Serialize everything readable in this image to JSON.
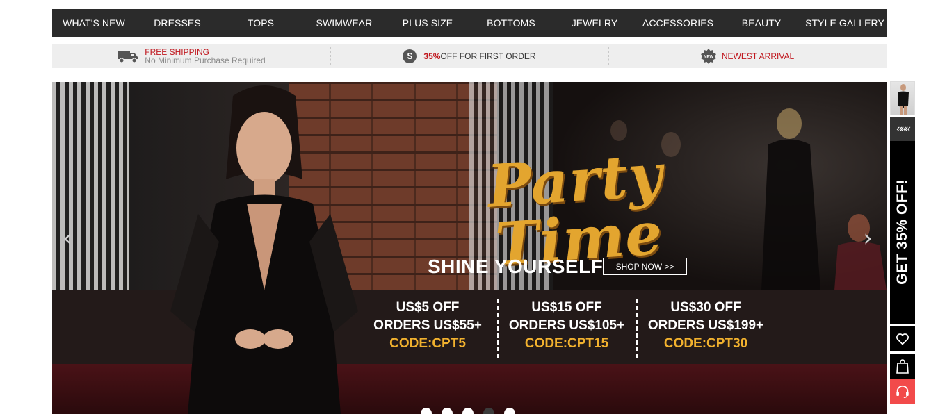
{
  "nav": {
    "items": [
      "WHAT'S NEW",
      "DRESSES",
      "TOPS",
      "SWIMWEAR",
      "PLUS SIZE",
      "BOTTOMS",
      "JEWELRY",
      "ACCESSORIES",
      "BEAUTY",
      "STYLE GALLERY"
    ]
  },
  "info": {
    "shipping_title": "FREE SHIPPING",
    "shipping_sub": "No Minimum Purchase Required",
    "discount_pct": "35%",
    "discount_text": "OFF FOR FIRST ORDER",
    "newest_badge": "NEW",
    "newest_text": "NEWEST ARRIVAL"
  },
  "hero": {
    "title": "Party Time",
    "tagline": "SHINE YOURSELF",
    "cta": "SHOP NOW >>",
    "offers": [
      {
        "line1": "US$5  OFF",
        "line2": "ORDERS US$55+",
        "code": "CODE:CPT5"
      },
      {
        "line1": "US$15  OFF",
        "line2": "ORDERS US$105+",
        "code": "CODE:CPT15"
      },
      {
        "line1": "US$30  OFF",
        "line2": "ORDERS US$199+",
        "code": "CODE:CPT30"
      }
    ],
    "prev_arrow": "‹",
    "next_arrow": "›",
    "slides_total": 5,
    "active_slide": 4
  },
  "sidebar": {
    "chevrons": "«««",
    "promo_text": "GET 35% OFF!"
  },
  "colors": {
    "nav_bg": "#2b2b2b",
    "accent_red": "#c0171e",
    "gold": "#e3a52f",
    "support_red": "#f24a4a"
  }
}
